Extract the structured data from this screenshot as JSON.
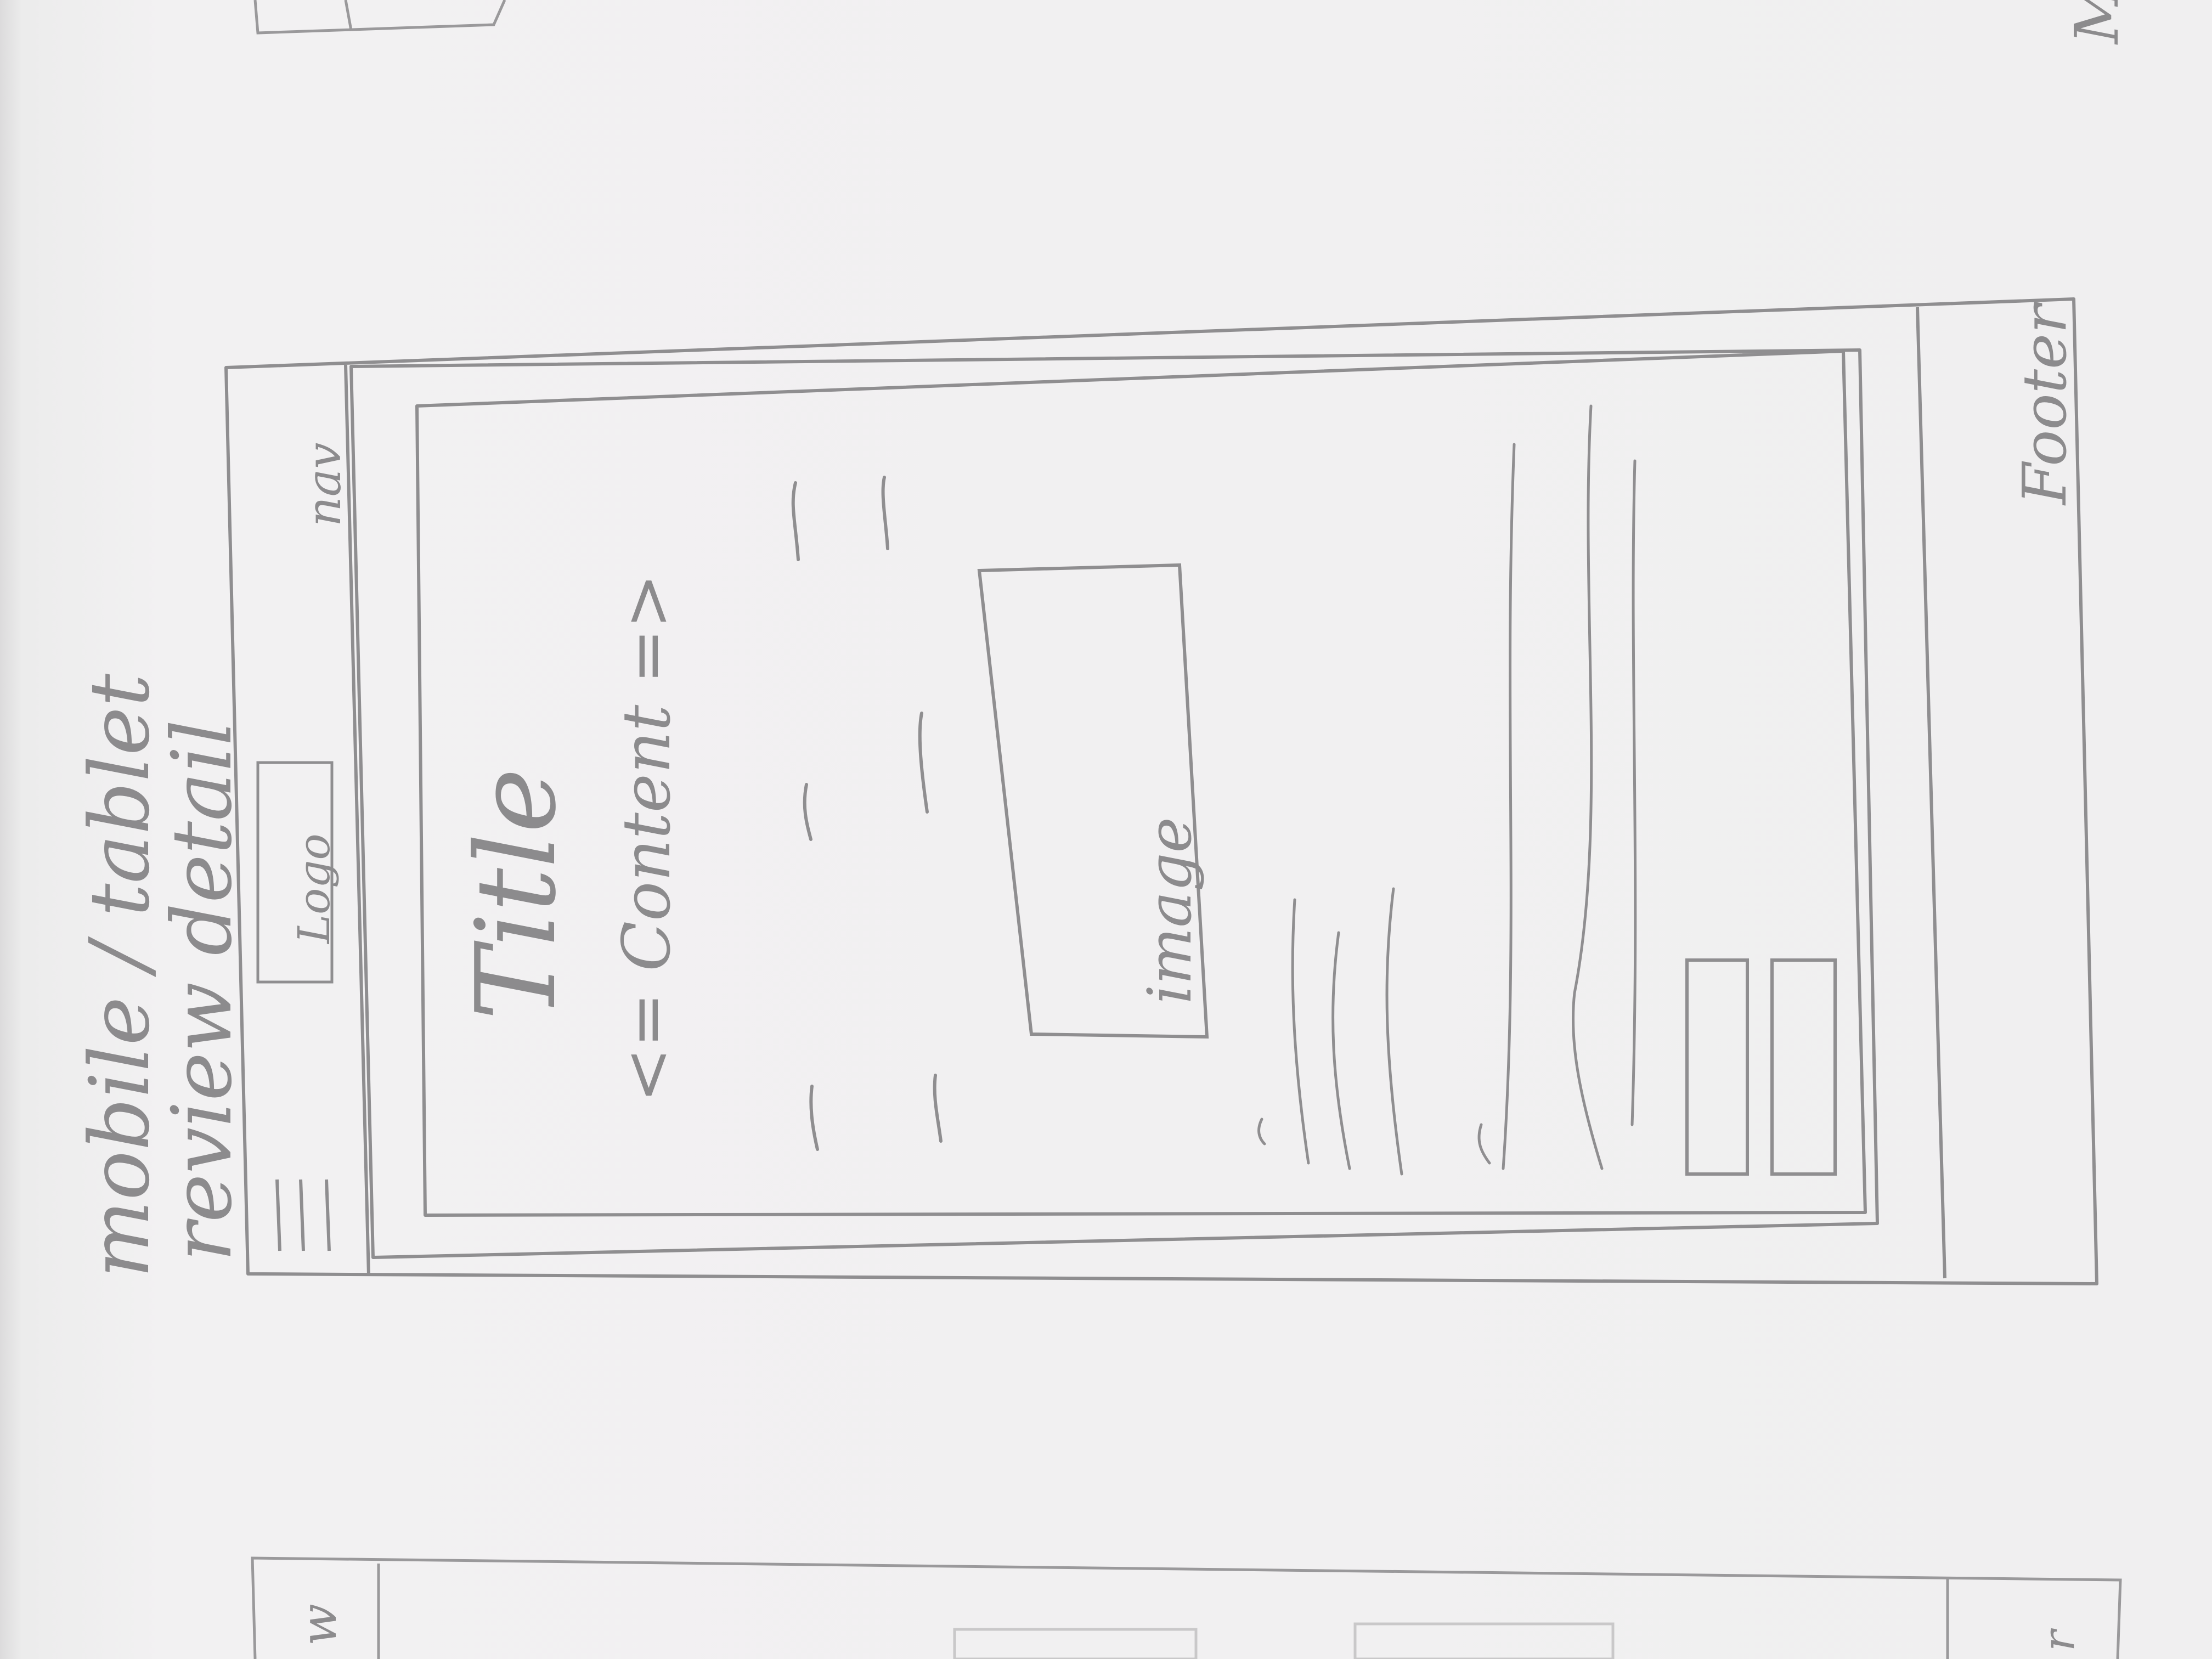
{
  "heading": {
    "line1": "mobile / tablet",
    "line2": "review detail"
  },
  "wireframe": {
    "header": {
      "logo_label": "Logo",
      "nav_label": "nav",
      "menu_icon": "hamburger-menu-icon"
    },
    "content": {
      "title": "Title",
      "content_label": "<= Content =>",
      "image_label": "image"
    },
    "footer": {
      "label": "Footer"
    }
  },
  "colors": {
    "paper": "#efeeef",
    "pencil": "#8c8b8d"
  }
}
